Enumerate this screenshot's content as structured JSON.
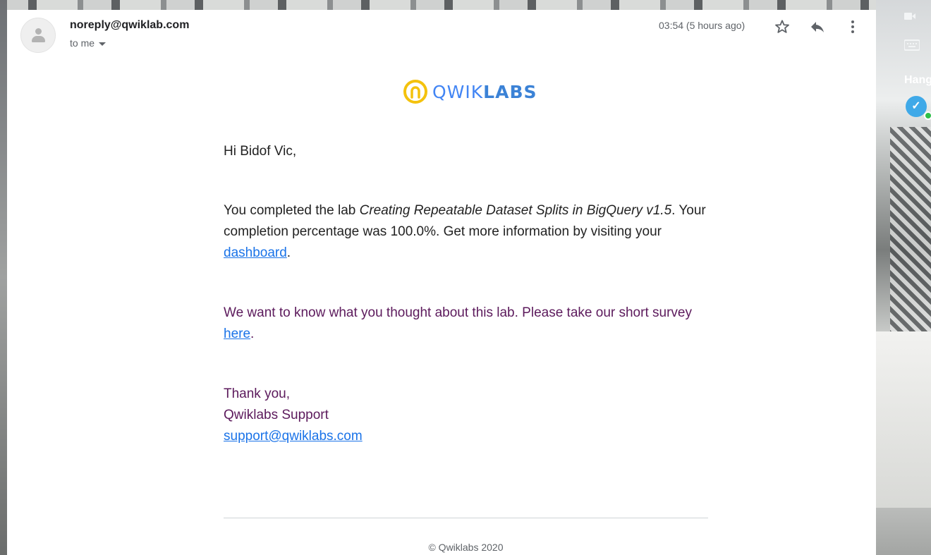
{
  "sender": {
    "email": "noreply@qwiklab.com",
    "to_label": "to me",
    "timestamp": "03:54 (5 hours ago)"
  },
  "sidebar": {
    "hangouts_label": "Hang"
  },
  "logo": {
    "light_text": "QWIK",
    "bold_text": "LABS",
    "color": "#4285f4",
    "ring_color": "#f4c20d"
  },
  "body": {
    "greeting": "Hi Bidof Vic,",
    "para1_prefix": "You completed the lab ",
    "lab_name": "Creating Repeatable Dataset Splits in BigQuery v1.5",
    "para1_middle": ". Your completion percentage was 100.0%. Get more information by visiting your ",
    "dashboard_link": "dashboard",
    "para1_suffix": ".",
    "para2_prefix": "We want to know what you thought about this lab. Please take our short survey ",
    "survey_link": "here",
    "para2_suffix": ".",
    "thanks": "Thank you,",
    "signature": "Qwiklabs Support",
    "support_email": "support@qwiklabs.com"
  },
  "footer": {
    "copyright": "© Qwiklabs 2020"
  },
  "colors": {
    "link": "#1a73e8",
    "purple_text": "#5c1a5c",
    "body_text": "#222222"
  }
}
